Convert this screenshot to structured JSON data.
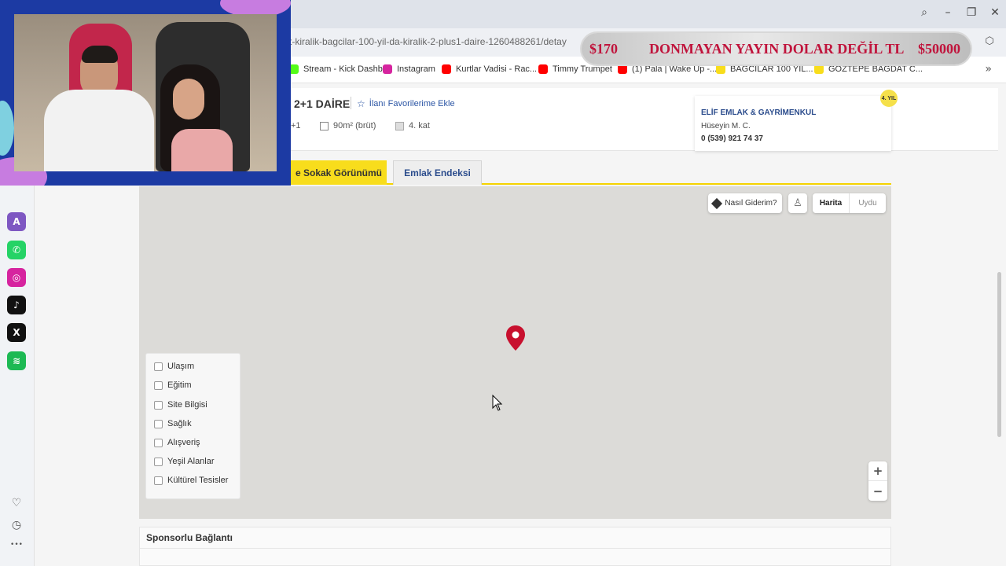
{
  "browser": {
    "url": "t-kiralik-bagcilar-100-yil-da-kiralik-2-plus1-daire-1260488261/detay",
    "window_controls": {
      "search": "⌕",
      "minimize": "–",
      "restore": "❐",
      "close": "✕"
    },
    "extension_icon": "⬡",
    "bookmarks": [
      {
        "label": "Stream - Kick Dashb...",
        "icon": "kick-icon",
        "color": "#53fc18"
      },
      {
        "label": "Instagram",
        "icon": "instagram-icon",
        "color": "#d6249f"
      },
      {
        "label": "Kurtlar Vadisi - Rac...",
        "icon": "youtube-icon",
        "color": "#ff0000"
      },
      {
        "label": "Timmy Trumpet",
        "icon": "youtube-icon",
        "color": "#ff0000"
      },
      {
        "label": "(1) Pala | Wake Up -...",
        "icon": "youtube-icon",
        "color": "#ff0000"
      },
      {
        "label": "BAĞCILAR 100 YIL...",
        "icon": "sahibinden-icon",
        "color": "#f8dd1c"
      },
      {
        "label": "GÖZTEPE BAĞDAT C...",
        "icon": "sahibinden-icon",
        "color": "#f8dd1c"
      }
    ],
    "more_bookmarks": "»"
  },
  "ticker": {
    "left": "$170",
    "message": "DONMAYAN YAYIN DOLAR DEĞİL TL",
    "right": "$50000"
  },
  "sidebar": {
    "apps": [
      {
        "name": "aria-icon",
        "glyph": "A",
        "color": "#7e57c2"
      },
      {
        "name": "whatsapp-icon",
        "glyph": "✆",
        "color": "#25d366"
      },
      {
        "name": "instagram-icon",
        "glyph": "◎",
        "color": "#d6249f"
      },
      {
        "name": "tiktok-icon",
        "glyph": "♪",
        "color": "#111111"
      },
      {
        "name": "x-icon",
        "glyph": "X",
        "color": "#111111"
      },
      {
        "name": "spotify-icon",
        "glyph": "≋",
        "color": "#1db954"
      }
    ],
    "utilities": [
      {
        "name": "heart-icon",
        "glyph": "♡"
      },
      {
        "name": "history-icon",
        "glyph": "◷"
      },
      {
        "name": "more-icon",
        "glyph": "•••"
      }
    ]
  },
  "listing": {
    "title": "2+1 DAİRE",
    "favorite_label": "İlanı Favorilerime Ekle",
    "rooms": "+1",
    "area": "90m² (brüt)",
    "floor": "4. kat"
  },
  "agent": {
    "company": "ELİF EMLAK & GAYRİMENKUL",
    "person": "Hüseyin M. C.",
    "phone": "0 (539) 921 74 37",
    "badge": "4. YIL"
  },
  "tabs": {
    "street_view": "e Sokak Görünümü",
    "index": "Emlak Endeksi"
  },
  "map": {
    "route_label": "Nasıl Giderim?",
    "map_type_map": "Harita",
    "map_type_satellite": "Uydu",
    "zoom_in": "+",
    "zoom_out": "−",
    "poi": [
      "Ulaşım",
      "Eğitim",
      "Site Bilgisi",
      "Sağlık",
      "Alışveriş",
      "Yeşil Alanlar",
      "Kültürel Tesisler"
    ]
  },
  "sponsor": {
    "title": "Sponsorlu Bağlantı"
  }
}
